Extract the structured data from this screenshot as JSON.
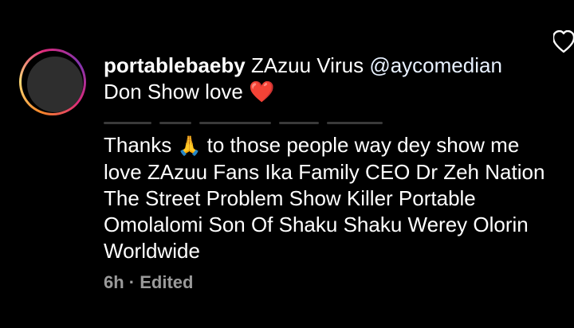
{
  "comment": {
    "username": "portablebaeby",
    "caption_lead": " ZAzuu Virus  ",
    "mention": "@aycomedian",
    "line2": "Don Show love ",
    "heart_emoji": "❤️",
    "body_before_emoji": "Thanks ",
    "pray_emoji": "🙏",
    "body_after_emoji": " to those people way dey show me love ZAzuu Fans Ika Family CEO Dr Zeh Nation The Street Problem Show Killer Portable Omolalomi Son Of Shaku Shaku Werey Olorin Worldwide",
    "timestamp": "6h",
    "separator": " · ",
    "edited_label": "Edited"
  },
  "icons": {
    "like": "heart-outline-icon",
    "avatar": "profile-avatar"
  },
  "colors": {
    "background": "#000000",
    "text": "#ffffff",
    "meta": "#9a9a9a",
    "heart": "#e0242e"
  }
}
